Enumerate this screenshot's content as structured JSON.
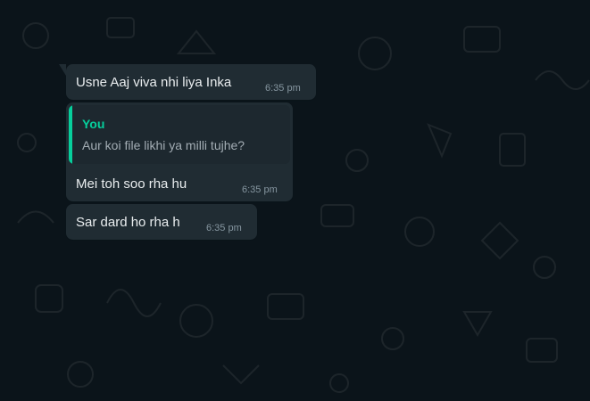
{
  "messages": [
    {
      "text": "Usne Aaj viva nhi liya Inka",
      "time": "6:35 pm"
    },
    {
      "quoted": {
        "author": "You",
        "text": "Aur koi file likhi ya milli tujhe?"
      },
      "text": "Mei toh soo rha hu",
      "time": "6:35 pm"
    },
    {
      "text": "Sar dard ho rha h",
      "time": "6:35 pm"
    }
  ],
  "colors": {
    "background": "#0b141a",
    "bubble_incoming": "#202c33",
    "quote_accent": "#06cf9c",
    "timestamp": "#8696a0"
  }
}
